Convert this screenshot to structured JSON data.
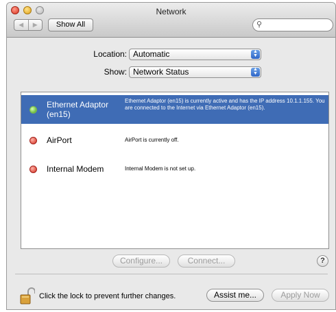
{
  "window": {
    "title": "Network"
  },
  "toolbar": {
    "back_label": "◀",
    "forward_label": "▶",
    "show_all_label": "Show All",
    "search_placeholder": ""
  },
  "location": {
    "label": "Location:",
    "value": "Automatic"
  },
  "show": {
    "label": "Show:",
    "value": "Network Status"
  },
  "services": [
    {
      "name": "Ethernet Adaptor (en15)",
      "status": "green",
      "selected": true,
      "description": "Ethernet Adaptor (en15) is currently active and has the IP address 10.1.1.155. You are connected to the Internet via Ethernet Adaptor (en15)."
    },
    {
      "name": "AirPort",
      "status": "red",
      "selected": false,
      "description": "AirPort is currently off."
    },
    {
      "name": "Internal Modem",
      "status": "red",
      "selected": false,
      "description": "Internal Modem is not set up."
    }
  ],
  "buttons": {
    "configure": "Configure...",
    "connect": "Connect...",
    "help": "?",
    "assist": "Assist me...",
    "apply": "Apply Now"
  },
  "lock": {
    "text": "Click the lock to prevent further changes."
  },
  "colors": {
    "selection": "#3f6cb5",
    "status_green": "#42a316",
    "status_red": "#d12a1c"
  }
}
